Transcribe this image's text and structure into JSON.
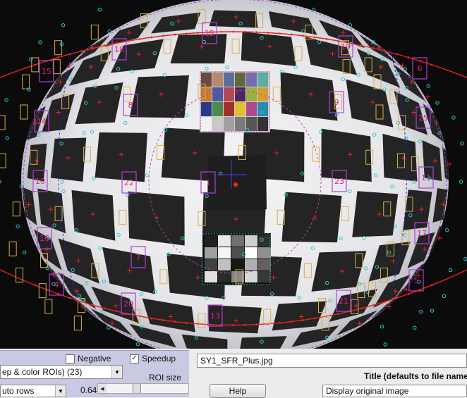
{
  "image_view": {
    "roi_labels": [
      {
        "id": "sfr-roi-12",
        "text": "12"
      },
      {
        "id": "sfr-roi-18",
        "text": "18"
      },
      {
        "id": "sfr-roi-19",
        "text": "19"
      },
      {
        "id": "sfr-roi-15",
        "text": "15"
      },
      {
        "id": "sfr-roi-6",
        "text": "6"
      },
      {
        "id": "sfr-roi-8",
        "text": "8"
      },
      {
        "id": "sfr-roi-9",
        "text": "9"
      },
      {
        "id": "sfr-roi-14",
        "text": "14"
      },
      {
        "id": "sfr-roi-25",
        "text": "25"
      },
      {
        "id": "sfr-roi-10",
        "text": "10"
      },
      {
        "id": "sfr-roi-22",
        "text": "22"
      },
      {
        "id": "sfr-roi-1",
        "text": "1"
      },
      {
        "id": "sfr-roi-23",
        "text": "23"
      },
      {
        "id": "sfr-roi-11",
        "text": "11"
      },
      {
        "id": "sfr-roi-16",
        "text": "16"
      },
      {
        "id": "sfr-roi-7",
        "text": "7"
      },
      {
        "id": "sfr-roi-17",
        "text": "17"
      },
      {
        "id": "sfr-roi-4",
        "text": "4"
      },
      {
        "id": "sfr-roi-5",
        "text": "5"
      },
      {
        "id": "sfr-roi-20",
        "text": "20"
      },
      {
        "id": "sfr-roi-21",
        "text": "21"
      },
      {
        "id": "sfr-roi-13",
        "text": "13"
      }
    ],
    "colors": {
      "roi_box": "#b040d8",
      "roi_text": "#e0208a",
      "edge_roi": "#d8b040",
      "marker_red": "#ff2020",
      "marker_cyan": "#30c8d0",
      "center_marker": "#4040ff",
      "boundary_curve": "#e82020"
    }
  },
  "controls": {
    "negative_label": "Negative",
    "negative_checked": false,
    "speedup_label": "Speedup",
    "speedup_checked": true,
    "roi_type_value": "ep & color ROIs) (23)",
    "rows_value": "uto rows",
    "roi_size_label": "ROI size",
    "roi_size_value": "0.64",
    "roi_size_fraction": 0.35,
    "file_name": "SY1_SFR_Plus.jpg",
    "title_label": "Title (defaults to file name",
    "help_label": "Help",
    "display_value": "Display original image"
  }
}
